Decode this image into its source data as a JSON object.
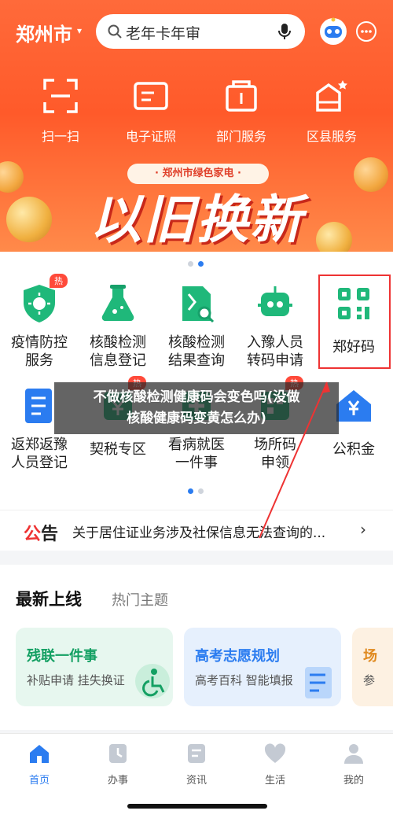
{
  "header": {
    "city": "郑州市",
    "search_placeholder": "老年卡年审"
  },
  "quick_actions": [
    {
      "label": "扫一扫",
      "icon": "scan-icon"
    },
    {
      "label": "电子证照",
      "icon": "id-card-icon"
    },
    {
      "label": "部门服务",
      "icon": "department-icon"
    },
    {
      "label": "区县服务",
      "icon": "district-icon"
    }
  ],
  "banner": {
    "tag": "· 郑州市绿色家电 ·",
    "title": "以旧换新"
  },
  "services_row1": [
    {
      "label_1": "疫情防控",
      "label_2": "服务",
      "badge": "热",
      "icon": "virus-shield-icon"
    },
    {
      "label_1": "核酸检测",
      "label_2": "信息登记",
      "icon": "flask-icon"
    },
    {
      "label_1": "核酸检测",
      "label_2": "结果查询",
      "icon": "report-search-icon"
    },
    {
      "label_1": "入豫人员",
      "label_2": "转码申请",
      "icon": "robot-code-icon"
    },
    {
      "label_1": "郑好码",
      "label_2": "",
      "icon": "qr-code-icon"
    }
  ],
  "services_row2": [
    {
      "label_1": "返郑返豫",
      "label_2": "人员登记",
      "icon": "checklist-icon"
    },
    {
      "label_1": "契税专区",
      "label_2": "",
      "badge": "热",
      "icon": "tax-icon"
    },
    {
      "label_1": "看病就医",
      "label_2": "一件事",
      "icon": "hospital-icon"
    },
    {
      "label_1": "场所码",
      "label_2": "申领",
      "badge": "热",
      "icon": "venue-code-icon"
    },
    {
      "label_1": "公积金",
      "label_2": "",
      "icon": "house-yuan-icon"
    }
  ],
  "overlay_caption": {
    "line_1": "不做核酸检测健康码会变色吗(没做",
    "line_2": "核酸健康码变黄怎么办)"
  },
  "notice": {
    "logo_a": "公",
    "logo_b": "告",
    "text": "关于居住证业务涉及社保信息无法查询的..."
  },
  "latest": {
    "tab_active": "最新上线",
    "tab_other": "热门主题",
    "cards": [
      {
        "title": "残联一件事",
        "subtitle": "补贴申请 挂失换证"
      },
      {
        "title": "高考志愿规划",
        "subtitle": "高考百科 智能填报"
      },
      {
        "title": "场",
        "subtitle": "参"
      }
    ]
  },
  "tabbar": [
    {
      "label": "首页",
      "icon": "home-icon",
      "active": true
    },
    {
      "label": "办事",
      "icon": "task-icon",
      "active": false
    },
    {
      "label": "资讯",
      "icon": "news-icon",
      "active": false
    },
    {
      "label": "生活",
      "icon": "heart-icon",
      "active": false
    },
    {
      "label": "我的",
      "icon": "user-icon",
      "active": false
    }
  ],
  "colors": {
    "brand_orange": "#ff5a2a",
    "accent_blue": "#2b7cf0",
    "icon_green": "#1fb87a",
    "highlight_red": "#e33333"
  }
}
